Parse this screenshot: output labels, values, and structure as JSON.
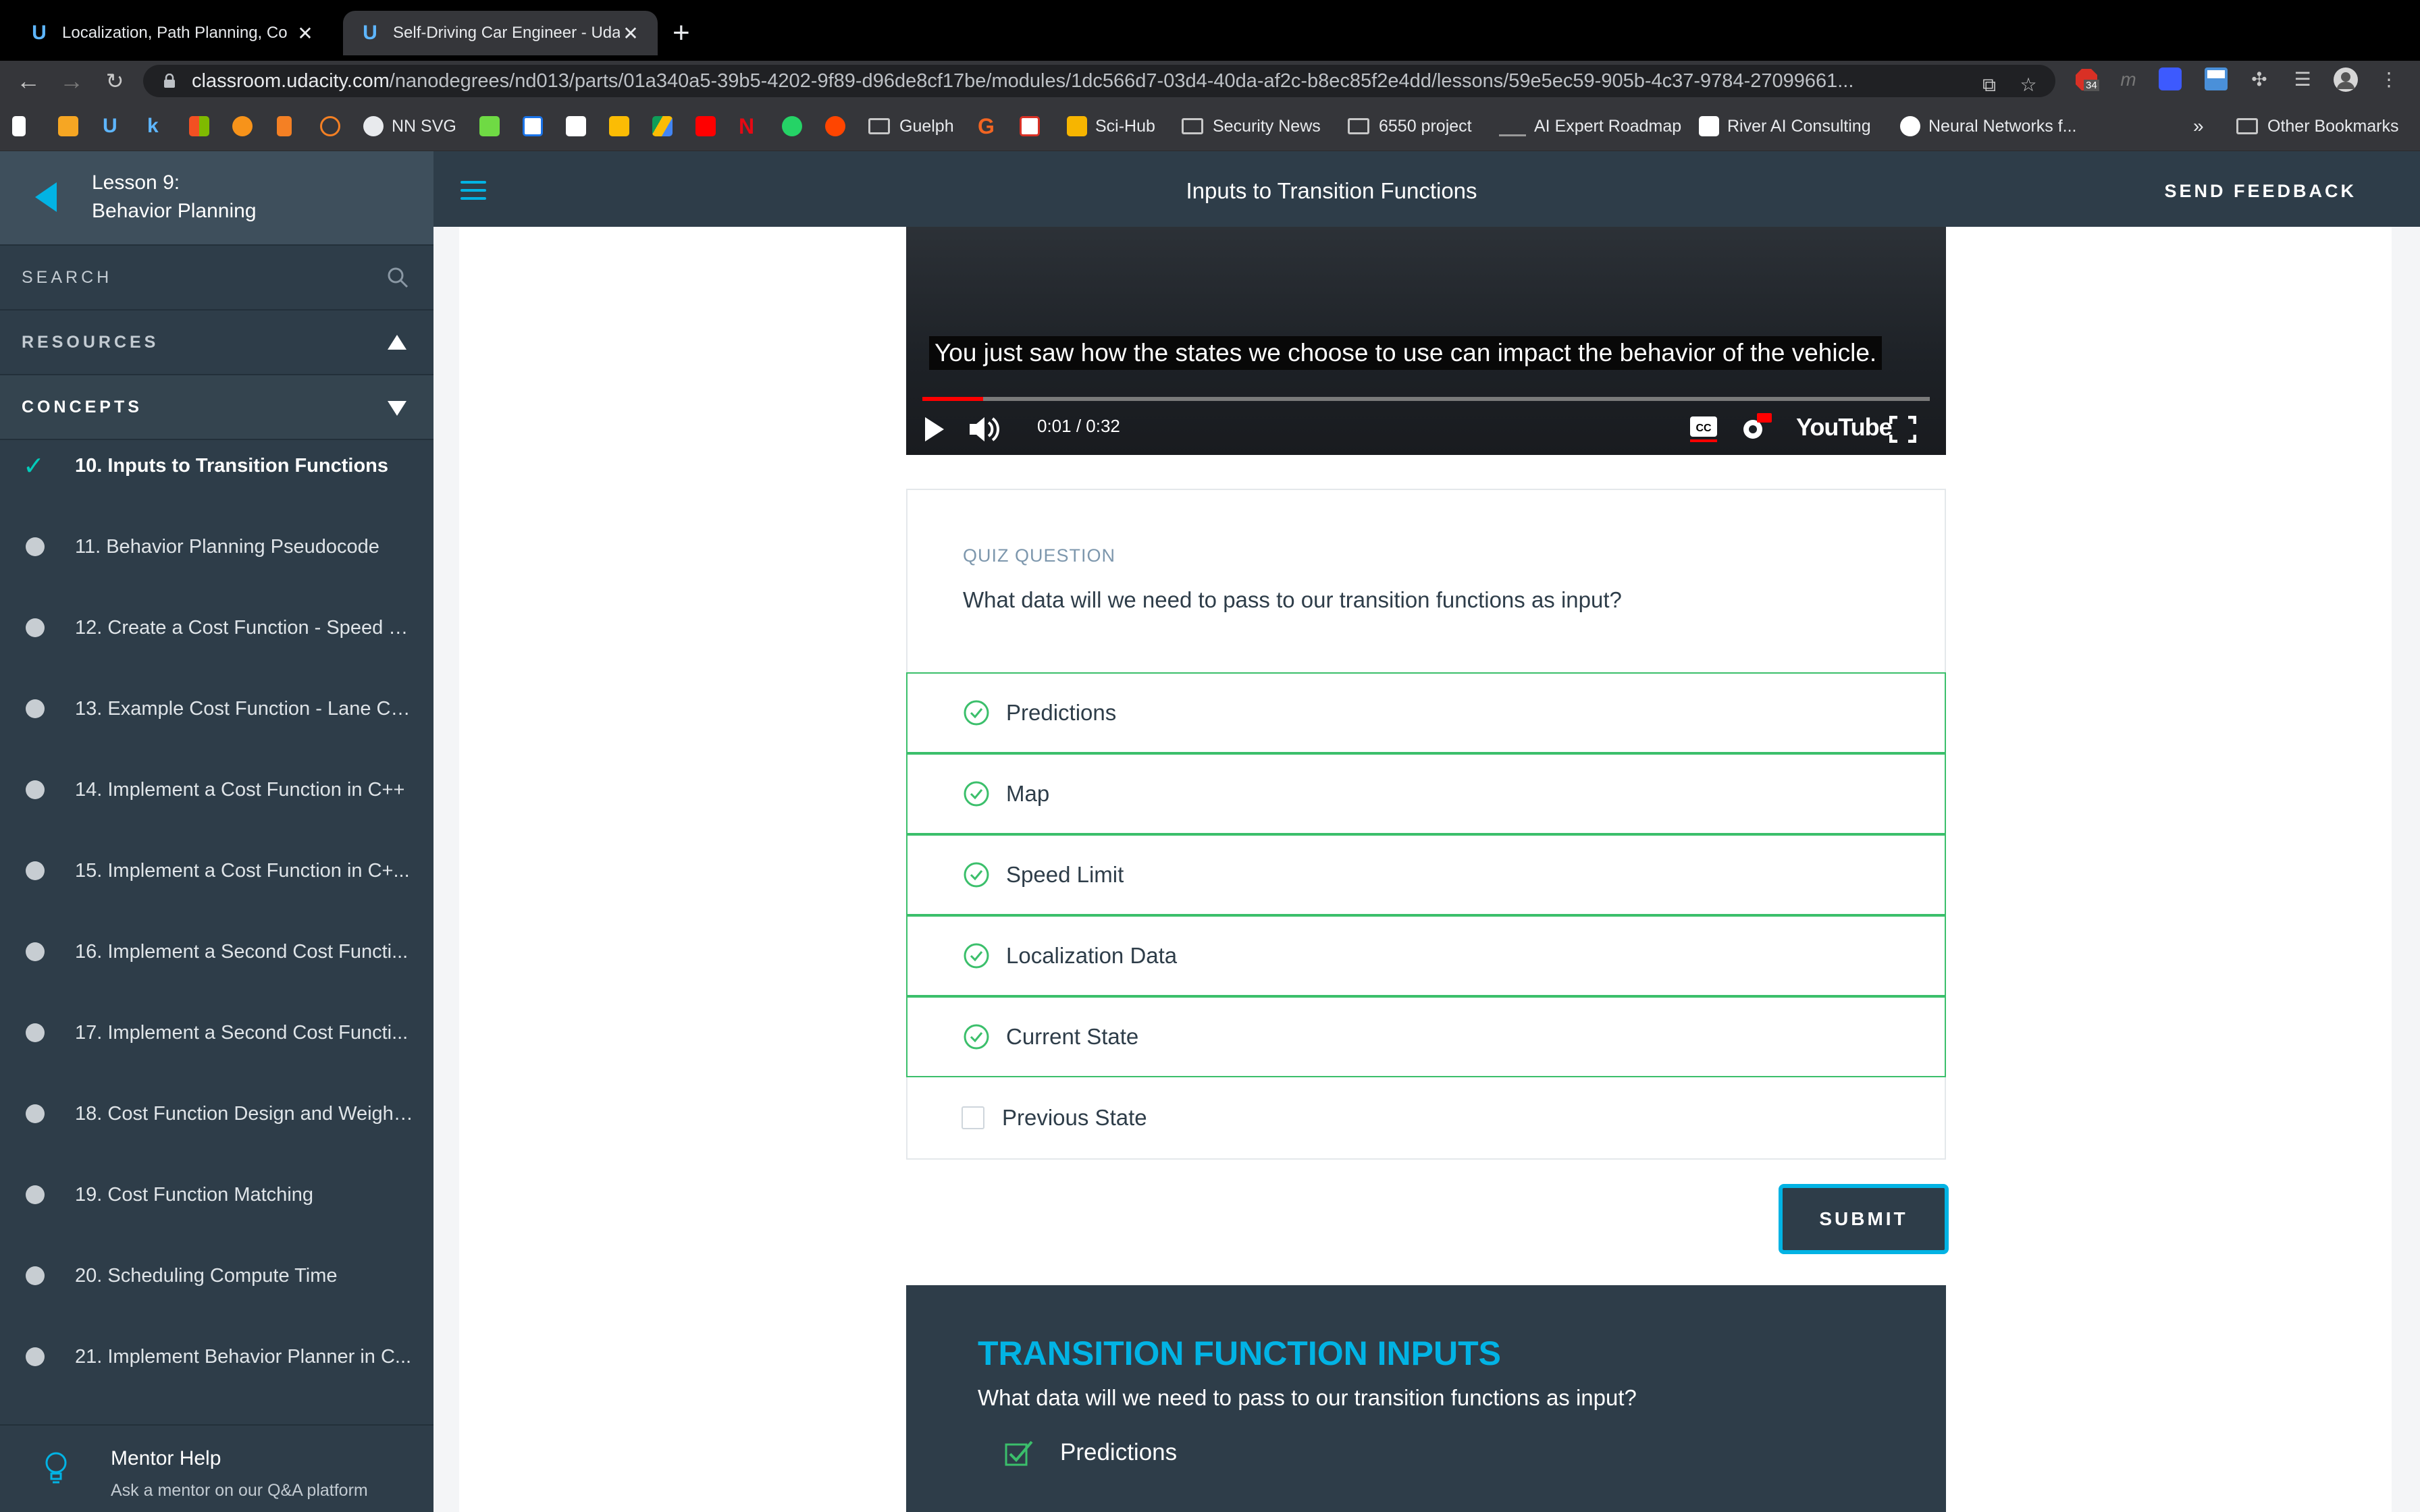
{
  "browser": {
    "tabs": [
      {
        "title": "Localization, Path Planning, Co",
        "active": false
      },
      {
        "title": "Self-Driving Car Engineer - Uda",
        "active": true
      }
    ],
    "url_host": "classroom.udacity.com",
    "url_path": "/nanodegrees/nd013/parts/01a340a5-39b5-4202-9f89-d96de8cf17be/modules/1dc566d7-03d4-40da-af2c-b8ec85f2e4dd/lessons/59e5ec59-905b-4c37-9784-27099661...",
    "extension_badge": "34",
    "bookmarks": [
      {
        "label": "NN SVG",
        "icon": "globe-icon"
      },
      {
        "label": "Guelph",
        "icon": "folder-icon"
      },
      {
        "label": "Sci-Hub",
        "icon": "scihub-icon"
      },
      {
        "label": "Security News",
        "icon": "folder-icon"
      },
      {
        "label": "6550 project",
        "icon": "folder-icon"
      },
      {
        "label": "AI Expert Roadmap",
        "icon": "roadmap-icon"
      },
      {
        "label": "River AI Consulting",
        "icon": "r-icon"
      },
      {
        "label": "Neural Networks f...",
        "icon": "nn-icon"
      }
    ],
    "overflow": "»",
    "other_bookmarks": "Other Bookmarks"
  },
  "sidebar": {
    "lesson_number": "Lesson 9:",
    "lesson_name": "Behavior Planning",
    "search_label": "SEARCH",
    "resources_label": "RESOURCES",
    "concepts_label": "CONCEPTS",
    "concepts": [
      {
        "label": "10. Inputs to Transition Functions",
        "done": true
      },
      {
        "label": "11. Behavior Planning Pseudocode",
        "done": false
      },
      {
        "label": "12. Create a Cost Function - Speed P...",
        "done": false
      },
      {
        "label": "13. Example Cost Function - Lane Ch...",
        "done": false
      },
      {
        "label": "14. Implement a Cost Function in C++",
        "done": false
      },
      {
        "label": "15. Implement a Cost Function in C+...",
        "done": false
      },
      {
        "label": "16. Implement a Second Cost Functi...",
        "done": false
      },
      {
        "label": "17. Implement a Second Cost Functi...",
        "done": false
      },
      {
        "label": "18. Cost Function Design and Weight...",
        "done": false
      },
      {
        "label": "19. Cost Function Matching",
        "done": false
      },
      {
        "label": "20. Scheduling Compute Time",
        "done": false
      },
      {
        "label": "21. Implement Behavior Planner in C...",
        "done": false
      }
    ],
    "mentor_title": "Mentor Help",
    "mentor_sub": "Ask a mentor on our Q&A platform"
  },
  "header": {
    "title": "Inputs to Transition Functions",
    "feedback": "SEND FEEDBACK"
  },
  "video": {
    "caption": "You just saw how the states we choose to use can impact the behavior of the vehicle.",
    "time": "0:01 / 0:32",
    "progress_fraction": 0.06,
    "brand": "YouTube"
  },
  "quiz": {
    "label": "QUIZ QUESTION",
    "question": "What data will we need to pass to our transition functions as input?",
    "options": [
      {
        "label": "Predictions",
        "checked": true
      },
      {
        "label": "Map",
        "checked": true
      },
      {
        "label": "Speed Limit",
        "checked": true
      },
      {
        "label": "Localization Data",
        "checked": true
      },
      {
        "label": "Current State",
        "checked": true
      },
      {
        "label": "Previous State",
        "checked": false
      }
    ],
    "submit": "SUBMIT"
  },
  "solution": {
    "title": "TRANSITION FUNCTION INPUTS",
    "question": "What data will we need to pass to our transition functions as input?",
    "first_item": "Predictions"
  },
  "colors": {
    "accent": "#02b3e4",
    "sidebar_bg": "#2e3d49",
    "correct_green": "#3bbf6b"
  }
}
